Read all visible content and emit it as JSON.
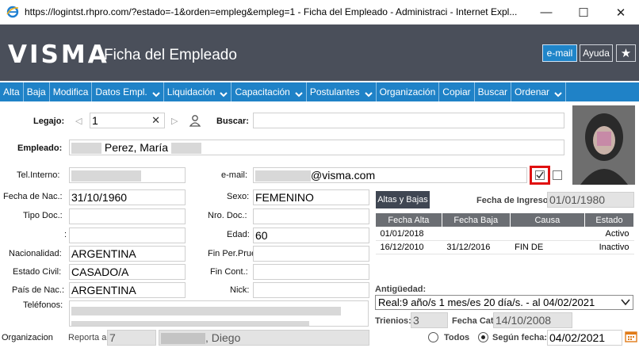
{
  "window": {
    "title": "https://logintst.rhpro.com/?estado=-1&orden=empleg&empleg=1 - Ficha del Empleado - Administraci - Internet Expl...",
    "minimize": "—",
    "maximize": "☐",
    "close": "✕"
  },
  "header": {
    "logo": "VISMA",
    "title": "Ficha del Empleado",
    "email_btn": "e-mail",
    "help_btn": "Ayuda",
    "fav_btn": "★"
  },
  "menu": [
    {
      "label": "Alta",
      "dropdown": false
    },
    {
      "label": "Baja",
      "dropdown": false
    },
    {
      "label": "Modifica",
      "dropdown": false
    },
    {
      "label": "Datos Empl.",
      "dropdown": true
    },
    {
      "label": "Liquidación",
      "dropdown": true
    },
    {
      "label": "Capacitación",
      "dropdown": true
    },
    {
      "label": "Postulantes",
      "dropdown": true
    },
    {
      "label": "Organización",
      "dropdown": false
    },
    {
      "label": "Copiar",
      "dropdown": false
    },
    {
      "label": "Buscar",
      "dropdown": false
    },
    {
      "label": "Ordenar",
      "dropdown": true
    }
  ],
  "form": {
    "legajo_label": "Legajo:",
    "legajo_value": "1",
    "buscar_label": "Buscar:",
    "empleado_label": "Empleado:",
    "empleado_value": "Perez, María",
    "telinterno_label": "Tel.Interno:",
    "email_label": "e-mail:",
    "email_value": "@visma.com",
    "fechanac_label": "Fecha de Nac.:",
    "fechanac_value": "31/10/1960",
    "sexo_label": "Sexo:",
    "sexo_value": "FEMENINO",
    "tipodoc_label": "Tipo Doc.:",
    "nrodoc_label": "Nro. Doc.:",
    "sep_label": ":",
    "edad_label": "Edad:",
    "edad_value": "60",
    "nacionalidad_label": "Nacionalidad:",
    "nacionalidad_value": "ARGENTINA",
    "finprueba_label": "Fin Per.Prueba:",
    "estadocivil_label": "Estado Civil:",
    "estadocivil_value": "CASADO/A",
    "fincont_label": "Fin Cont.:",
    "paisnac_label": "País de Nac.:",
    "paisnac_value": "ARGENTINA",
    "nick_label": "Nick:",
    "telefonos_label": "Teléfonos:",
    "organizacion_label": "Organizacion",
    "reporta_label": "Reporta a:",
    "reporta_value": "7",
    "reporta_name": ", Diego"
  },
  "altas": {
    "button": "Altas y Bajas",
    "fecha_ingreso_label": "Fecha de Ingreso:",
    "fecha_ingreso_value": "01/01/1980",
    "columns": [
      "Fecha Alta",
      "Fecha Baja",
      "Causa",
      "Estado"
    ],
    "rows": [
      [
        "01/01/2018",
        "",
        "",
        "Activo"
      ],
      [
        "16/12/2010",
        "31/12/2016",
        "FIN DE",
        "Inactivo"
      ]
    ]
  },
  "antiguedad": {
    "label": "Antigüedad:",
    "selected": "Real:9 año/s 1 mes/es 20 día/s. - al 04/02/2021",
    "trienios_label": "Trienios:",
    "trienios_value": "3",
    "fechacat_label": "Fecha Cat:",
    "fechacat_value": "14/10/2008",
    "todos_label": "Todos",
    "segun_label": "Según fecha:",
    "segun_value": "04/02/2021"
  },
  "colors": {
    "menu_bg": "#1f82c7",
    "header_bg": "#4a4f5a",
    "highlight": "#e01010"
  }
}
